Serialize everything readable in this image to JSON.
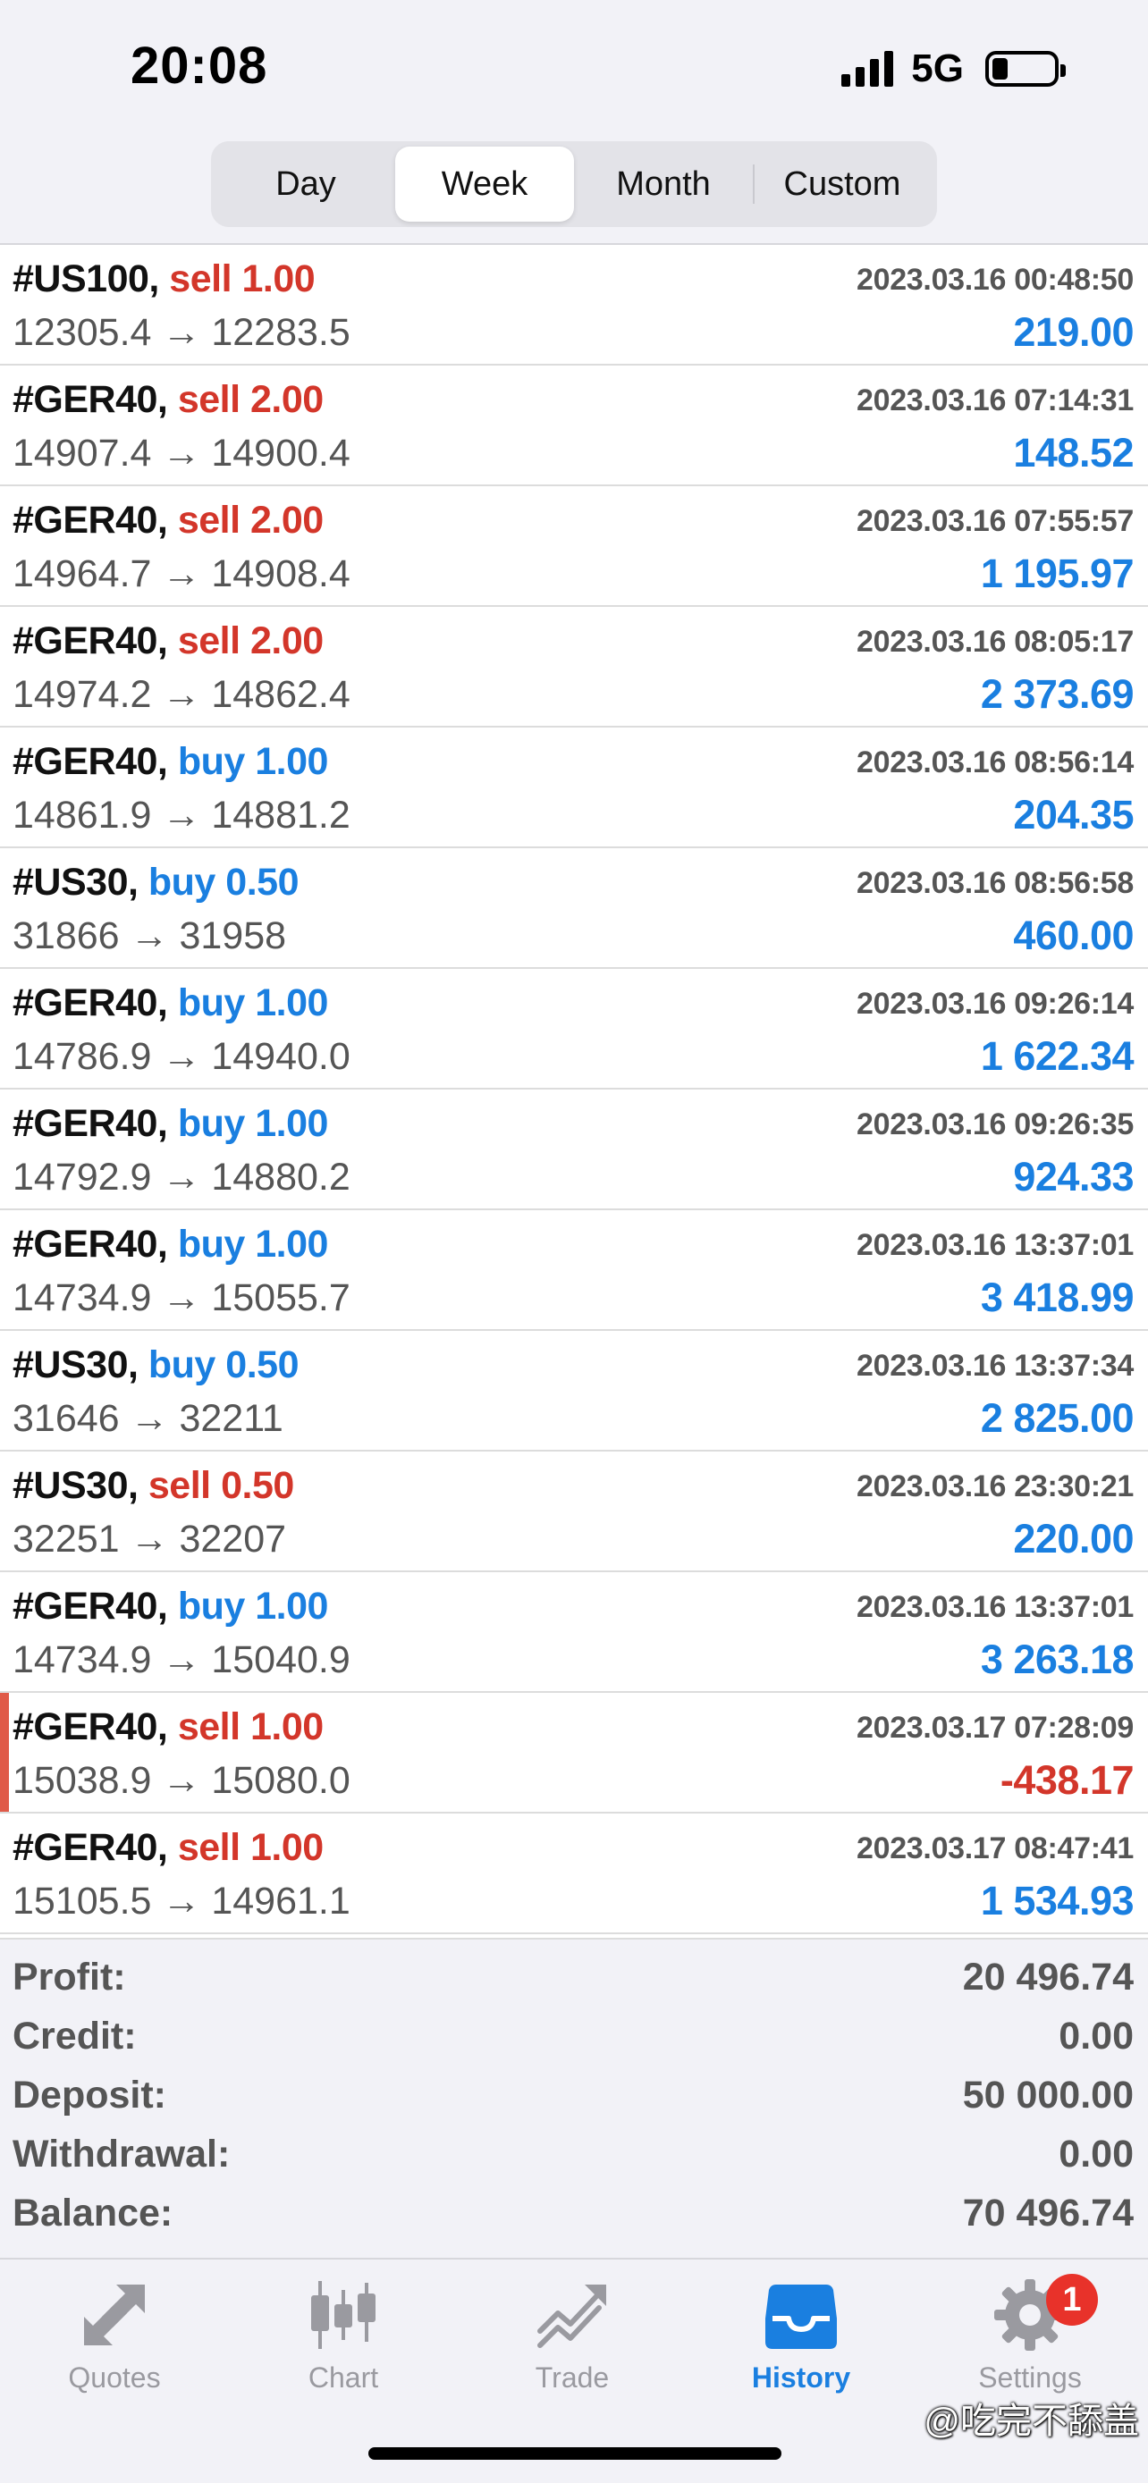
{
  "status_bar": {
    "time": "20:08",
    "network": "5G",
    "battery_level": 0.25
  },
  "period_tabs": [
    {
      "label": "Day",
      "active": false
    },
    {
      "label": "Week",
      "active": true
    },
    {
      "label": "Month",
      "active": false
    },
    {
      "label": "Custom",
      "active": false
    }
  ],
  "trades": [
    {
      "symbol": "#US100,",
      "side": "sell",
      "volume": "1.00",
      "datetime": "2023.03.16 00:48:50",
      "prices": "12305.4 → 12283.5",
      "profit": "219.00",
      "negative": false
    },
    {
      "symbol": "#GER40,",
      "side": "sell",
      "volume": "2.00",
      "datetime": "2023.03.16 07:14:31",
      "prices": "14907.4 → 14900.4",
      "profit": "148.52",
      "negative": false
    },
    {
      "symbol": "#GER40,",
      "side": "sell",
      "volume": "2.00",
      "datetime": "2023.03.16 07:55:57",
      "prices": "14964.7 → 14908.4",
      "profit": "1 195.97",
      "negative": false
    },
    {
      "symbol": "#GER40,",
      "side": "sell",
      "volume": "2.00",
      "datetime": "2023.03.16 08:05:17",
      "prices": "14974.2 → 14862.4",
      "profit": "2 373.69",
      "negative": false
    },
    {
      "symbol": "#GER40,",
      "side": "buy",
      "volume": "1.00",
      "datetime": "2023.03.16 08:56:14",
      "prices": "14861.9 → 14881.2",
      "profit": "204.35",
      "negative": false
    },
    {
      "symbol": "#US30,",
      "side": "buy",
      "volume": "0.50",
      "datetime": "2023.03.16 08:56:58",
      "prices": "31866 → 31958",
      "profit": "460.00",
      "negative": false
    },
    {
      "symbol": "#GER40,",
      "side": "buy",
      "volume": "1.00",
      "datetime": "2023.03.16 09:26:14",
      "prices": "14786.9 → 14940.0",
      "profit": "1 622.34",
      "negative": false
    },
    {
      "symbol": "#GER40,",
      "side": "buy",
      "volume": "1.00",
      "datetime": "2023.03.16 09:26:35",
      "prices": "14792.9 → 14880.2",
      "profit": "924.33",
      "negative": false
    },
    {
      "symbol": "#GER40,",
      "side": "buy",
      "volume": "1.00",
      "datetime": "2023.03.16 13:37:01",
      "prices": "14734.9 → 15055.7",
      "profit": "3 418.99",
      "negative": false
    },
    {
      "symbol": "#US30,",
      "side": "buy",
      "volume": "0.50",
      "datetime": "2023.03.16 13:37:34",
      "prices": "31646 → 32211",
      "profit": "2 825.00",
      "negative": false
    },
    {
      "symbol": "#US30,",
      "side": "sell",
      "volume": "0.50",
      "datetime": "2023.03.16 23:30:21",
      "prices": "32251 → 32207",
      "profit": "220.00",
      "negative": false
    },
    {
      "symbol": "#GER40,",
      "side": "buy",
      "volume": "1.00",
      "datetime": "2023.03.16 13:37:01",
      "prices": "14734.9 → 15040.9",
      "profit": "3 263.18",
      "negative": false
    },
    {
      "symbol": "#GER40,",
      "side": "sell",
      "volume": "1.00",
      "datetime": "2023.03.17 07:28:09",
      "prices": "15038.9 → 15080.0",
      "profit": "-438.17",
      "negative": true
    },
    {
      "symbol": "#GER40,",
      "side": "sell",
      "volume": "1.00",
      "datetime": "2023.03.17 08:47:41",
      "prices": "15105.5 → 14961.1",
      "profit": "1 534.93",
      "negative": false
    }
  ],
  "summary": [
    {
      "label": "Profit:",
      "value": "20 496.74"
    },
    {
      "label": "Credit:",
      "value": "0.00"
    },
    {
      "label": "Deposit:",
      "value": "50 000.00"
    },
    {
      "label": "Withdrawal:",
      "value": "0.00"
    },
    {
      "label": "Balance:",
      "value": "70 496.74"
    }
  ],
  "tabbar": {
    "items": [
      {
        "label": "Quotes",
        "icon": "quotes-arrows-icon",
        "active": false
      },
      {
        "label": "Chart",
        "icon": "candlestick-chart-icon",
        "active": false
      },
      {
        "label": "Trade",
        "icon": "trade-trend-icon",
        "active": false
      },
      {
        "label": "History",
        "icon": "history-inbox-icon",
        "active": true
      },
      {
        "label": "Settings",
        "icon": "gear-icon",
        "active": false
      }
    ],
    "settings_badge": "1"
  },
  "watermark": "@吃完不舔盖",
  "colors": {
    "sell": "#d3362a",
    "buy": "#1a7fe0",
    "negative": "#d3362a",
    "positive": "#1a7fe0",
    "active_tab": "#1a7fe0",
    "badge": "#e8322a"
  }
}
